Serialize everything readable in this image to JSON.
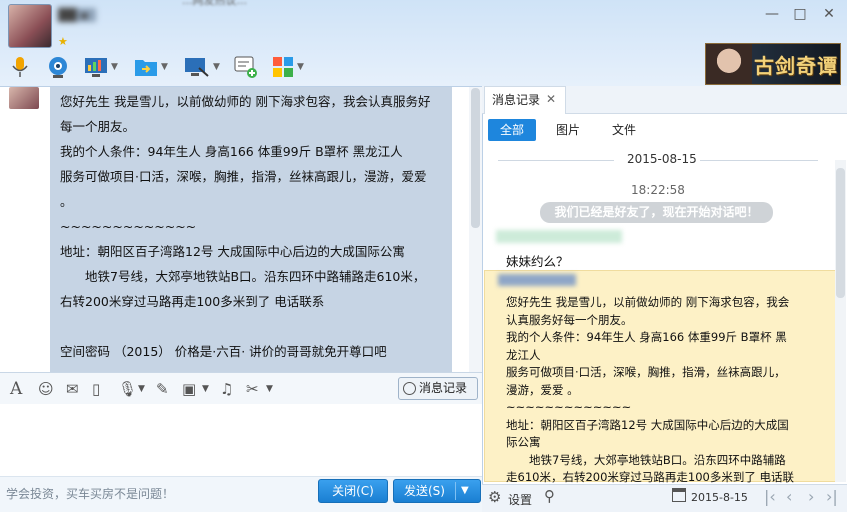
{
  "titlebar": {
    "contact_name": "██ ▪",
    "top_news": "...网友热议..."
  },
  "window": {
    "min_label": "—",
    "max_label": "□",
    "close_label": "✕"
  },
  "ad": {
    "title": "古剑奇谭"
  },
  "chat": {
    "lines": [
      "您好先生 我是雪儿，以前做幼师的 刚下海求包容，我会认真服务好",
      "每一个朋友。",
      "我的个人条件：94年生人 身高166 体重99斤 B罩杯 黑龙江人",
      "服务可做项目·口活，深喉，胸推，指滑，丝袜高跟儿，漫游，爱爱",
      "。",
      "~~~~~~~~~~~~~",
      "地址：朝阳区百子湾路12号 大成国际中心后边的大成国际公寓",
      "　　地铁7号线，大郊亭地铁站B口。沿东四环中路辅路走610米，",
      "右转200米穿过马路再走100多米到了 电话联系",
      "",
      "空间密码 （2015） 价格是·六百· 讲价的哥哥就免开尊口吧"
    ]
  },
  "input_toolbar": {
    "history_label": "消息记录"
  },
  "bottom": {
    "tip": "学会投资，买车买房不是问题！",
    "close_label": "关闭(C)",
    "send_label": "发送(S)"
  },
  "history_panel": {
    "tab_label": "消息记录",
    "filters": {
      "all": "全部",
      "pictures": "图片",
      "files": "文件"
    },
    "date": "2015-08-15",
    "time": "18:22:58",
    "system_notice": "我们已经是好友了，现在开始对话吧！",
    "message1": "妹妹约么？",
    "highlight_lines": [
      "您好先生 我是雪儿，以前做幼师的 刚下海求包容，我会",
      "认真服务好每一个朋友。",
      "我的个人条件：94年生人 身高166 体重99斤 B罩杯 黑",
      "龙江人",
      "服务可做项目·口活，深喉，胸推，指滑，丝袜高跟儿，",
      "漫游，爱爱 。",
      "~~~~~~~~~~~~~",
      "地址：朝阳区百子湾路12号 大成国际中心后边的大成国",
      "际公寓",
      "　　地铁7号线，大郊亭地铁站B口。沿东四环中路辅路",
      "走610米，右转200米穿过马路再走100多米到了 电话联"
    ],
    "footer": {
      "settings_label": "设置",
      "date": "2015-8-15"
    }
  },
  "colors": {
    "accent": "#1e86dd",
    "highlight": "#fdf1c6",
    "bubble": "#c6d4e4"
  }
}
